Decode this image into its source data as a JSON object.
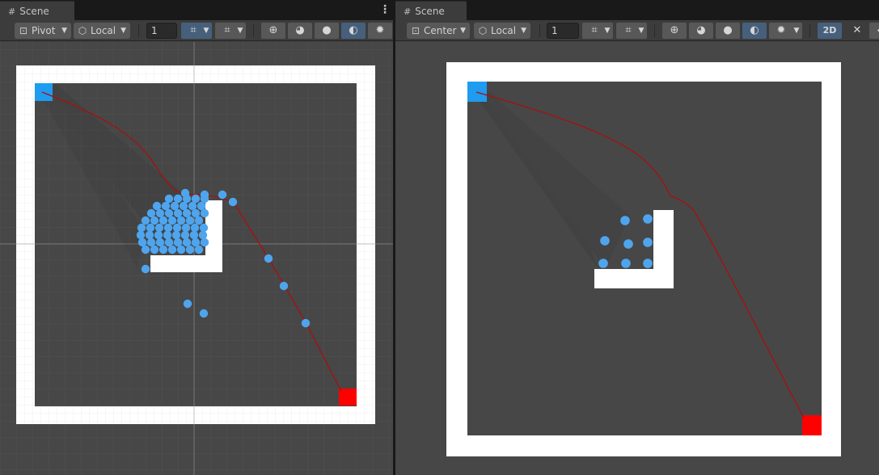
{
  "left_view": {
    "tab_title": "Scene",
    "tab_menu": "⋮",
    "toolbar": {
      "pivot_label": "Pivot",
      "space_label": "Local",
      "snap_value": "1"
    }
  },
  "right_view": {
    "tab_title": "Scene",
    "tab_menu": "⋮",
    "toolbar": {
      "pivot_label": "Center",
      "space_label": "Local",
      "snap_value": "1",
      "mode_2d_label": "2D"
    }
  },
  "icons": {
    "tab": "#",
    "pivot": "pivot-icon",
    "local": "cube-icon",
    "grid_snap": "grid-snap-icon",
    "increment_snap": "increment-snap-icon",
    "wireframe": "globe-wireframe-icon",
    "shaded_wireframe": "shaded-wireframe-icon",
    "shaded": "shaded-sphere-icon",
    "lighting": "lighting-icon",
    "debug": "bug-icon",
    "audio": "audio-mute-icon"
  },
  "colors": {
    "start_marker": "#1f9bf0",
    "goal_marker": "#ff0000",
    "agent": "#4ea5ee",
    "path": "#a80f0f",
    "wall": "#ffffff",
    "floor": "#474747",
    "active_button": "#46607c"
  }
}
